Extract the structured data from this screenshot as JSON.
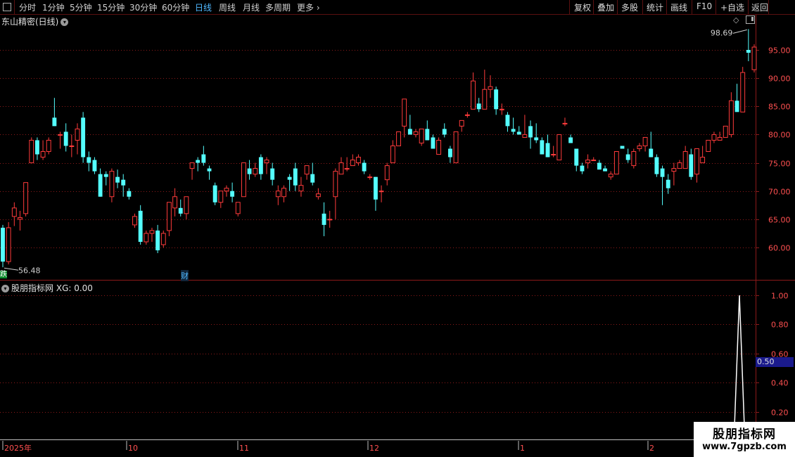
{
  "toolbar": {
    "periods": [
      "分时",
      "1分钟",
      "5分钟",
      "15分钟",
      "30分钟",
      "60分钟",
      "日线",
      "周线",
      "月线",
      "多周期",
      "更多"
    ],
    "active_period": "日线",
    "right_menu": [
      "复权",
      "叠加",
      "多股",
      "统计",
      "画线",
      "F10",
      "+自选",
      "返回"
    ]
  },
  "stock": {
    "title": "东山精密(日线)"
  },
  "indicator": {
    "title": "股朋指标网",
    "xg_label": "XG: 0.00",
    "current_value": "0.50"
  },
  "price_axis": {
    "ticks": [
      "95.00",
      "90.00",
      "85.00",
      "80.00",
      "75.00",
      "70.00",
      "65.00",
      "60.00"
    ]
  },
  "indicator_axis": {
    "ticks": [
      "1.00",
      "0.80",
      "0.60",
      "0.40",
      "0.20"
    ]
  },
  "annotations": {
    "high_label": "98.69",
    "low_label": "56.48"
  },
  "date_axis": {
    "labels": [
      "2025年",
      "10",
      "11",
      "12",
      "1",
      "2"
    ]
  },
  "badges": {
    "finance": "财",
    "left": "跌"
  },
  "watermark": {
    "line1": "股朋指标网",
    "line2": "www.7gpzb.com"
  },
  "colors": {
    "up": "#ff3b3b",
    "down": "#54ffff",
    "grid": "#8c1a1a",
    "axis_text": "#ff5050",
    "indicator_line": "#ffffff"
  },
  "chart_data": {
    "type": "candlestick",
    "ohlc": [
      [
        63.5,
        64,
        56.5,
        57.5
      ],
      [
        57.5,
        64.5,
        57,
        63.5
      ],
      [
        65.5,
        68,
        63.8,
        67
      ],
      [
        65,
        66.5,
        63,
        65.3
      ],
      [
        66,
        71.5,
        65.5,
        71.5
      ],
      [
        75,
        79.5,
        75,
        79
      ],
      [
        79,
        79.5,
        75.5,
        76.5
      ],
      [
        76,
        79,
        75.5,
        77
      ],
      [
        77,
        79.5,
        76.5,
        79
      ],
      [
        83,
        86.5,
        81.5,
        81.5
      ],
      [
        80,
        80.5,
        77.5,
        80
      ],
      [
        80.5,
        82,
        77,
        78
      ],
      [
        78,
        80,
        76,
        78
      ],
      [
        79,
        82,
        76.5,
        81
      ],
      [
        83,
        84,
        75,
        76
      ],
      [
        76,
        77,
        73.5,
        75
      ],
      [
        75.5,
        76,
        73,
        73.5
      ],
      [
        73,
        74,
        69,
        69
      ],
      [
        73,
        73.5,
        71,
        72.5
      ],
      [
        69,
        74,
        68,
        73.5
      ],
      [
        72.5,
        73.8,
        70.5,
        71.5
      ],
      [
        72,
        73,
        69,
        71
      ],
      [
        70,
        70.5,
        68.5,
        69
      ],
      [
        64,
        66,
        63.5,
        65.5
      ],
      [
        66.5,
        67.5,
        60.5,
        61
      ],
      [
        61,
        63,
        60.5,
        62.5
      ],
      [
        62.5,
        63.5,
        61,
        63
      ],
      [
        63,
        64,
        59,
        59.5
      ],
      [
        60.5,
        63,
        60,
        62.5
      ],
      [
        63,
        68,
        62,
        68
      ],
      [
        67,
        70.5,
        65.5,
        69
      ],
      [
        67,
        68.5,
        65.5,
        66
      ],
      [
        66,
        69,
        65,
        69
      ],
      [
        74,
        75,
        72,
        75
      ],
      [
        75.5,
        76,
        73.5,
        75
      ],
      [
        76.5,
        78,
        74.5,
        75
      ],
      [
        74,
        74.5,
        72,
        73.5
      ],
      [
        71,
        71.5,
        67.5,
        68
      ],
      [
        68,
        70,
        67,
        70
      ],
      [
        70,
        71,
        69,
        70.5
      ],
      [
        70,
        71.5,
        68,
        69
      ],
      [
        66,
        68,
        65.5,
        68
      ],
      [
        69,
        75,
        69,
        75
      ],
      [
        74,
        75.5,
        72,
        73
      ],
      [
        73,
        75,
        72.5,
        74
      ],
      [
        76,
        76.5,
        72,
        73
      ],
      [
        75,
        76,
        73,
        75.5
      ],
      [
        74,
        75,
        71,
        72
      ],
      [
        69,
        71,
        67.5,
        70
      ],
      [
        69,
        71,
        68,
        70.5
      ],
      [
        72.5,
        73,
        70,
        72
      ],
      [
        74,
        75,
        70,
        71
      ],
      [
        70,
        72.5,
        69,
        71
      ],
      [
        73,
        74.5,
        72,
        74.5
      ],
      [
        73,
        75,
        71,
        71.5
      ],
      [
        69,
        70.5,
        68.5,
        69.5
      ],
      [
        66,
        68,
        62,
        64
      ],
      [
        65,
        66.5,
        63.5,
        65
      ],
      [
        69,
        74,
        65,
        73.5
      ],
      [
        73,
        76,
        73,
        75
      ],
      [
        74,
        76,
        73.5,
        74
      ],
      [
        74.5,
        76.5,
        74.5,
        75.5
      ],
      [
        75,
        76.5,
        74.5,
        76
      ],
      [
        75,
        75.5,
        73,
        73.5
      ],
      [
        72.5,
        73,
        72,
        72.5
      ],
      [
        72.5,
        72.5,
        66.5,
        68.5
      ],
      [
        70,
        71,
        68,
        70
      ],
      [
        72,
        75,
        71,
        74.5
      ],
      [
        75,
        79,
        75,
        78
      ],
      [
        78,
        80,
        78,
        80.5
      ],
      [
        81.5,
        86,
        79.5,
        86.3
      ],
      [
        81,
        83.5,
        80,
        80
      ],
      [
        80,
        81,
        79.5,
        80.5
      ],
      [
        78.5,
        81,
        78,
        81
      ],
      [
        81,
        82.5,
        79,
        79
      ],
      [
        79.5,
        80,
        77.5,
        77.5
      ],
      [
        76.5,
        79.5,
        76.5,
        79
      ],
      [
        81,
        82,
        79.5,
        80
      ],
      [
        77.5,
        78,
        75,
        76
      ],
      [
        75,
        80.5,
        75,
        80.5
      ],
      [
        81.5,
        82.5,
        80.5,
        82.5
      ],
      [
        83.5,
        84,
        83,
        83.5
      ],
      [
        84.5,
        91,
        84.5,
        89.5
      ],
      [
        85.5,
        86.5,
        84,
        84.5
      ],
      [
        84.5,
        91.5,
        84.5,
        88
      ],
      [
        88,
        90.5,
        86.5,
        88.5
      ],
      [
        88,
        88.5,
        83.5,
        84.5
      ],
      [
        84.5,
        85.5,
        83.5,
        84.5
      ],
      [
        83.5,
        84,
        80.5,
        81.5
      ],
      [
        81,
        83,
        80,
        80.5
      ],
      [
        80.5,
        81.5,
        80,
        80
      ],
      [
        79.5,
        83.5,
        79.5,
        80
      ],
      [
        81.5,
        82.5,
        77.5,
        79.5
      ],
      [
        79.5,
        82,
        78.5,
        79
      ],
      [
        79,
        79.5,
        76.5,
        76.5
      ],
      [
        78.5,
        80,
        76,
        76
      ],
      [
        76.5,
        78,
        76,
        76.5
      ],
      [
        75.5,
        80,
        75.5,
        80
      ],
      [
        82,
        83,
        81.5,
        82
      ],
      [
        79.5,
        80,
        78.5,
        78.5
      ],
      [
        77.5,
        77.5,
        73.5,
        74.5
      ],
      [
        74.5,
        75,
        73,
        73.5
      ],
      [
        75,
        76.5,
        74,
        75.5
      ],
      [
        75.5,
        76,
        75.5,
        75.5
      ],
      [
        75,
        75.5,
        74.5,
        73.8
      ],
      [
        74,
        74.5,
        73.5,
        73.5
      ],
      [
        72.5,
        73.5,
        72,
        73
      ],
      [
        73,
        76.5,
        73,
        77
      ],
      [
        78,
        78,
        77.5,
        77.5
      ],
      [
        76.5,
        77.5,
        75,
        75.5
      ],
      [
        74.5,
        77.5,
        74,
        77
      ],
      [
        77.5,
        78.5,
        77,
        78
      ],
      [
        78,
        79.5,
        77,
        79.5
      ],
      [
        77.5,
        80.5,
        76,
        76
      ],
      [
        76,
        76.5,
        72.5,
        73
      ],
      [
        74,
        74.5,
        67.5,
        72.5
      ],
      [
        72,
        73,
        69.5,
        70.5
      ],
      [
        73.5,
        75,
        71,
        74
      ],
      [
        74,
        75.5,
        74,
        75
      ],
      [
        74,
        78,
        74.5,
        77
      ],
      [
        76.5,
        77.5,
        72,
        72.5
      ],
      [
        73,
        77.5,
        71.5,
        77.5
      ],
      [
        75,
        78,
        75,
        76
      ],
      [
        77,
        79,
        77,
        79
      ],
      [
        79,
        80.5,
        78.5,
        80
      ],
      [
        79,
        80.5,
        79,
        79.5
      ],
      [
        79.5,
        81.5,
        79.5,
        81.5
      ],
      [
        80,
        87.5,
        79.5,
        86
      ],
      [
        86,
        89,
        84.5,
        84
      ],
      [
        84,
        92,
        84,
        91
      ],
      [
        95,
        98.69,
        93,
        94.5
      ],
      [
        91.5,
        96,
        91,
        95.5
      ]
    ],
    "indicator_xg": {
      "values": [
        0,
        1.0,
        0
      ],
      "peak_value": 1.0
    },
    "price_range": [
      56.48,
      98.69
    ],
    "indicator_range": [
      0,
      1.0
    ]
  }
}
